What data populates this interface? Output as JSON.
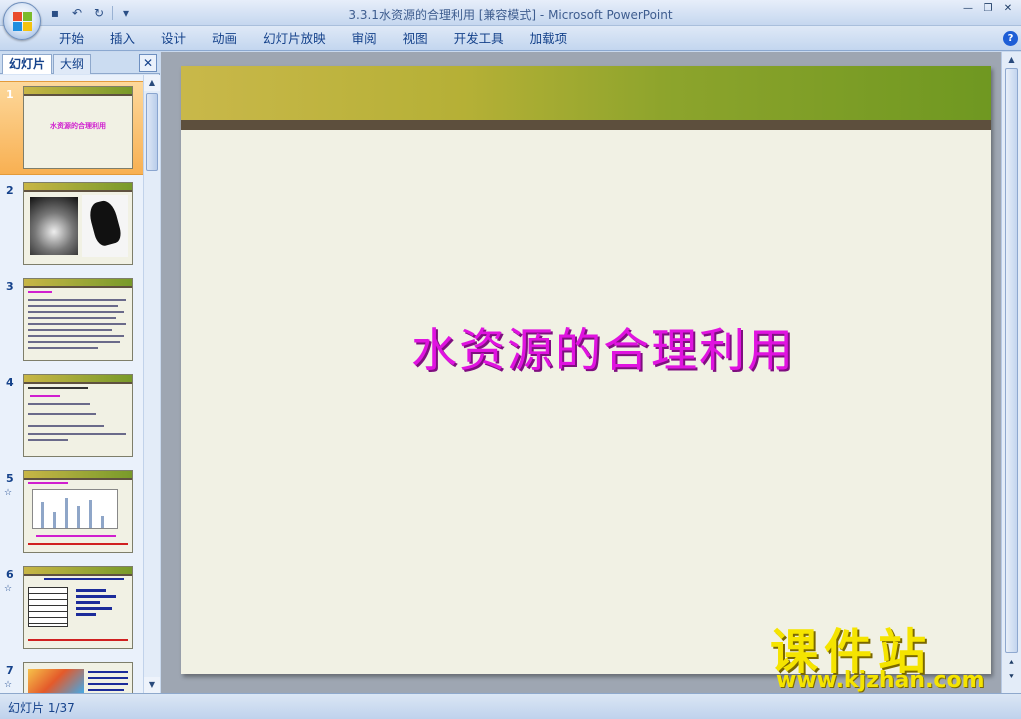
{
  "window": {
    "title": "3.3.1水资源的合理利用 [兼容模式] - Microsoft PowerPoint"
  },
  "quick_access": {
    "save_icon": "save-icon",
    "undo_icon": "undo-icon",
    "redo_icon": "redo-icon"
  },
  "ribbon": {
    "tabs": [
      "开始",
      "插入",
      "设计",
      "动画",
      "幻灯片放映",
      "审阅",
      "视图",
      "开发工具",
      "加载项"
    ]
  },
  "panel": {
    "tabs": [
      "幻灯片",
      "大纲"
    ],
    "close": "✕"
  },
  "thumbnails": [
    {
      "num": "1",
      "title": "水资源的合理利用",
      "selected": true
    },
    {
      "num": "2"
    },
    {
      "num": "3"
    },
    {
      "num": "4"
    },
    {
      "num": "5",
      "anim": "☆"
    },
    {
      "num": "6",
      "anim": "☆"
    },
    {
      "num": "7",
      "anim": "☆"
    }
  ],
  "slide": {
    "title": "水资源的合理利用"
  },
  "status": {
    "text": "幻灯片 1/37"
  },
  "watermark": {
    "text": "课件站",
    "url": "www.kjzhan.com"
  },
  "colors": {
    "accent": "#e013e0",
    "band_start": "#c9b84a",
    "band_end": "#6f9821",
    "selection": "#f8b052"
  }
}
